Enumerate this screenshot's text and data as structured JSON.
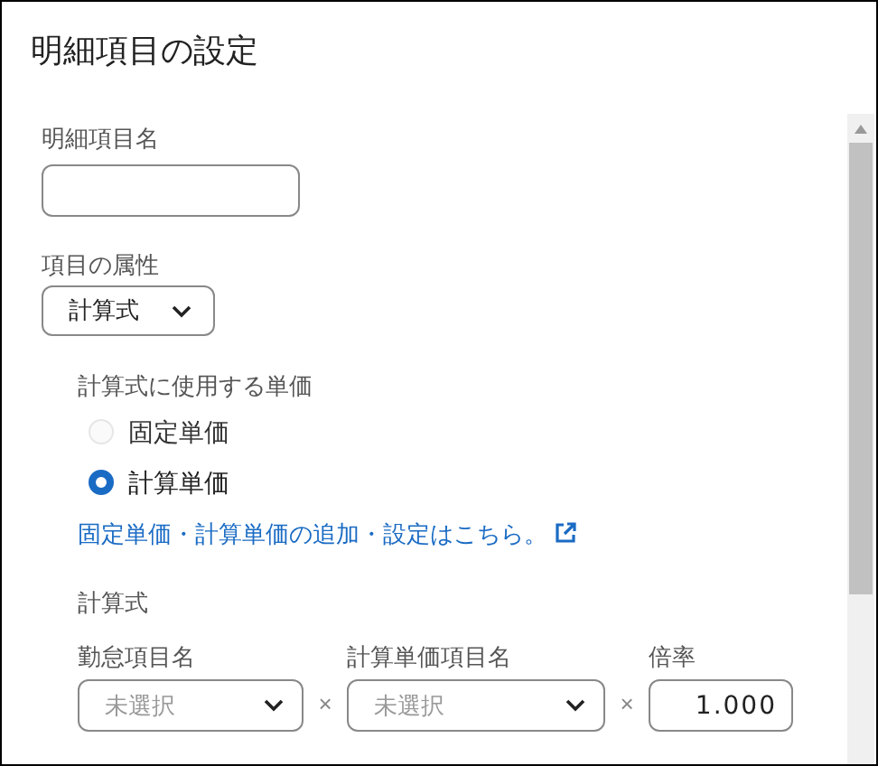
{
  "dialog": {
    "title": "明細項目の設定"
  },
  "name_field": {
    "label": "明細項目名"
  },
  "attribute": {
    "label": "項目の属性",
    "value": "計算式"
  },
  "unit_price": {
    "label": "計算式に使用する単価",
    "options": [
      {
        "label": "固定単価",
        "selected": false,
        "disabled": true
      },
      {
        "label": "計算単価",
        "selected": true,
        "disabled": false
      }
    ],
    "link": "固定単価・計算単価の追加・設定はこちら。"
  },
  "formula": {
    "label": "計算式",
    "operands": [
      {
        "kind": "select",
        "label": "勤怠項目名",
        "placeholder": "未選択"
      },
      {
        "kind": "select",
        "label": "計算単価項目名",
        "placeholder": "未選択"
      },
      {
        "kind": "number",
        "label": "倍率",
        "value": "1.000"
      }
    ],
    "operator": "×"
  }
}
